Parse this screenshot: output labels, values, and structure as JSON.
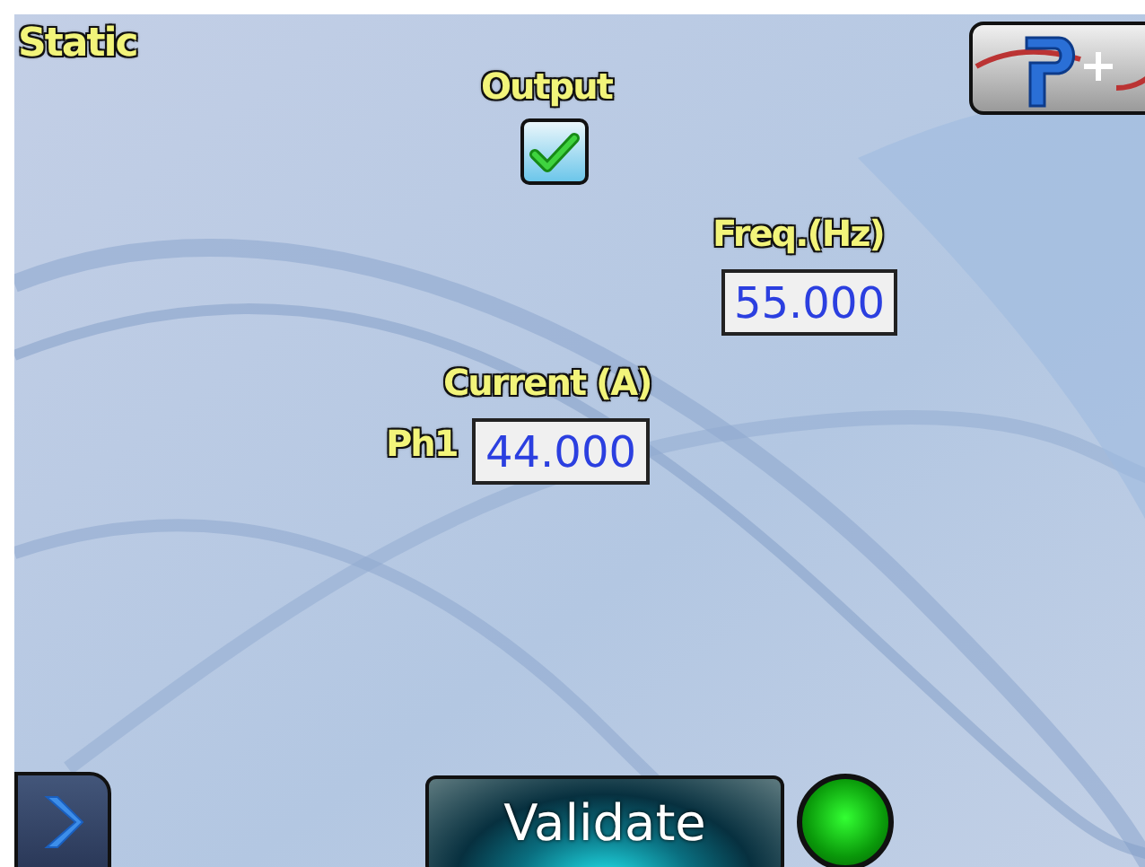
{
  "title": "Static",
  "output": {
    "label": "Output",
    "checked": true
  },
  "frequency": {
    "label": "Freq.(Hz)",
    "value": "55.000"
  },
  "current": {
    "label": "Current (A)",
    "phase_label": "Ph1",
    "value": "44.000"
  },
  "validate_button": {
    "label": "Validate"
  },
  "indicator": {
    "on": true
  }
}
